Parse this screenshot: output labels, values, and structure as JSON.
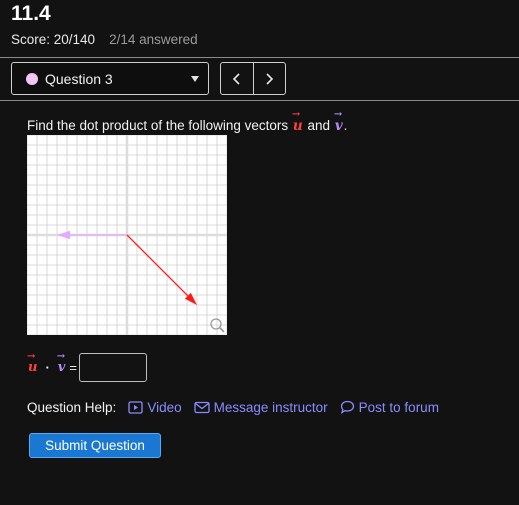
{
  "header": {
    "title": "11.4",
    "score": "Score: 20/140",
    "answered": "2/14 answered"
  },
  "question_nav": {
    "selected": "Question 3",
    "status_color": "#f2c6f5",
    "prev_icon": "chevron-left-icon",
    "next_icon": "chevron-right-icon"
  },
  "question": {
    "prompt_before": "Find the dot product of the following vectors",
    "vec_u": "u",
    "conjunction": "and",
    "vec_v": "v",
    "period": "."
  },
  "graph": {
    "grid": true,
    "zoom_icon": "magnifier-icon",
    "axis_color": "#dcdcdc",
    "grid_color": "#cfcfcf",
    "vectors": [
      {
        "name": "u",
        "from": [
          0,
          0
        ],
        "to": [
          3.5,
          -3.5
        ],
        "color": "#ff1a1a"
      },
      {
        "name": "v",
        "from": [
          0,
          0
        ],
        "to": [
          -3.5,
          0
        ],
        "color": "#e4a8ff"
      }
    ],
    "x_range": [
      -5,
      5
    ],
    "y_range": [
      -5,
      5
    ]
  },
  "answer": {
    "u": "u",
    "dot": "·",
    "v": "v",
    "equals": "=",
    "value": ""
  },
  "help": {
    "label": "Question Help:",
    "video": "Video",
    "message": "Message instructor",
    "forum": "Post to forum"
  },
  "submit_label": "Submit Question",
  "colors": {
    "background": "#121212",
    "link": "#8b8bff",
    "submit": "#1a78d2",
    "vec_u": "#ff4040",
    "vec_v": "#b48cff"
  }
}
